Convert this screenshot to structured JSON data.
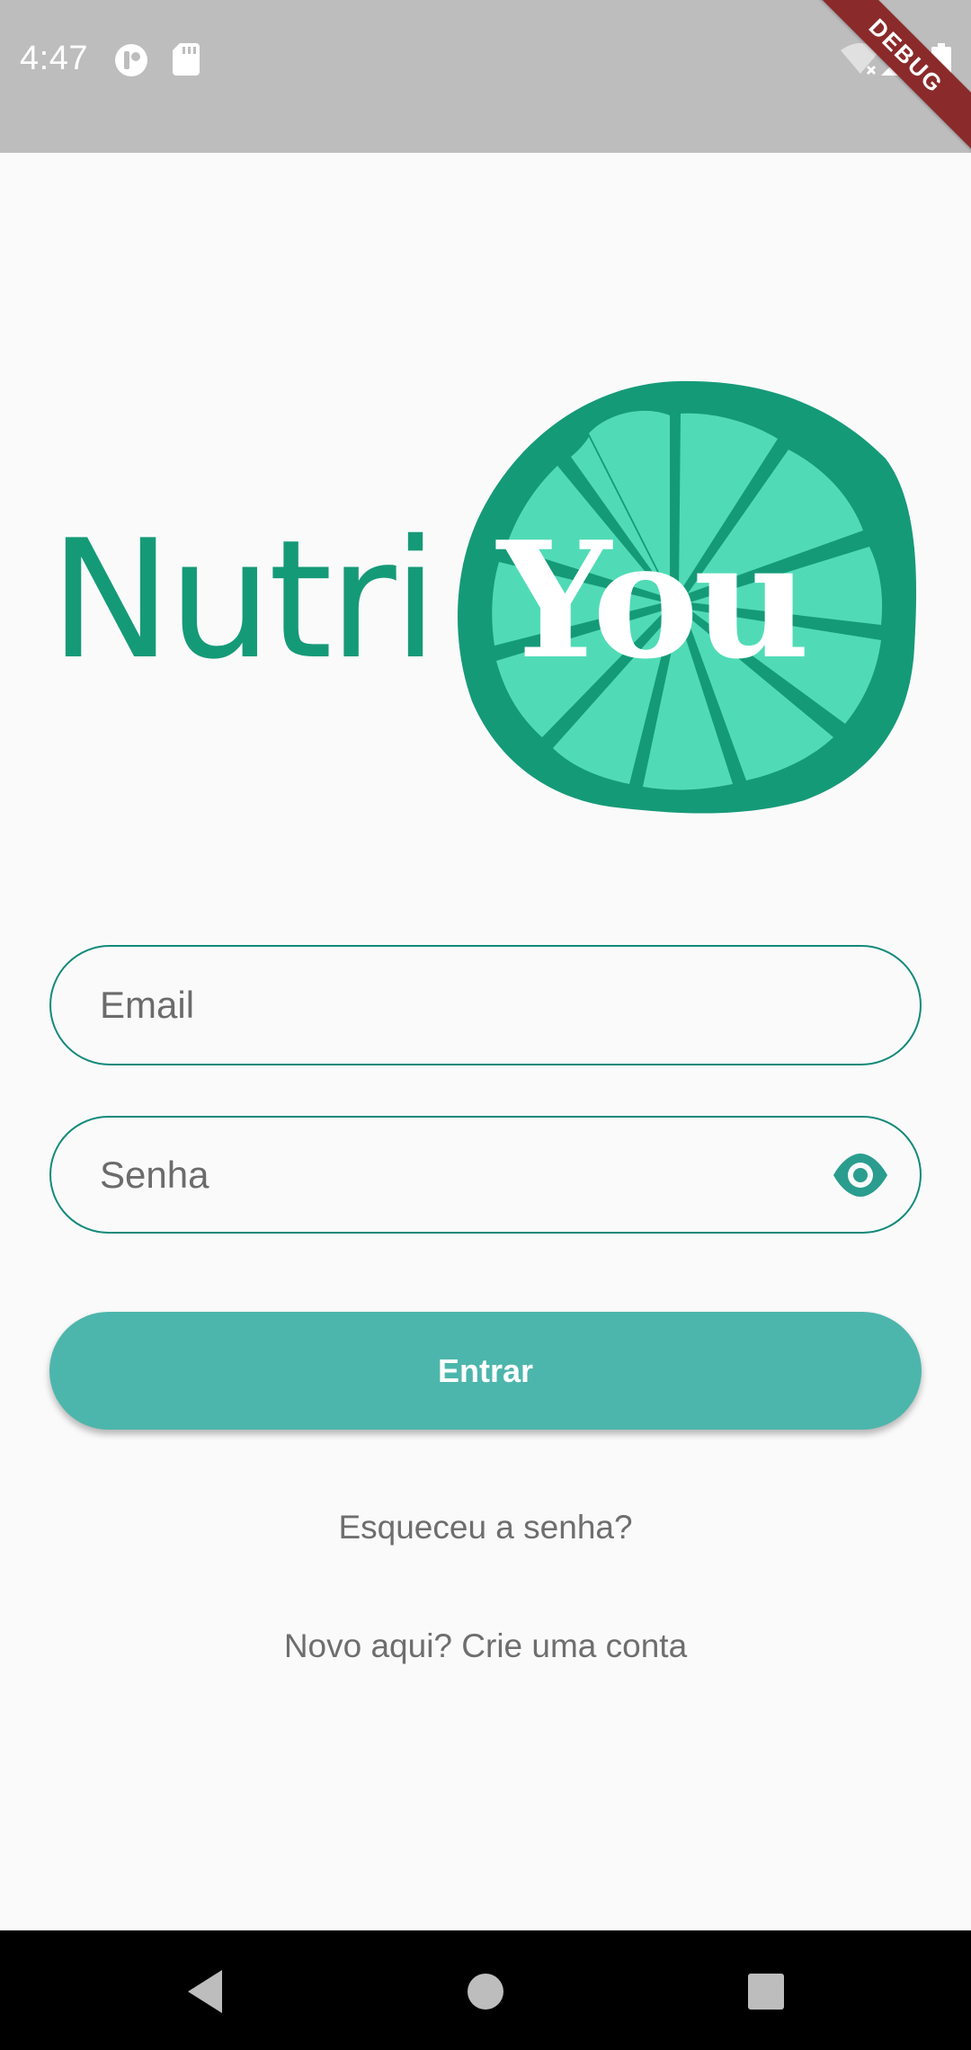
{
  "status_bar": {
    "time": "4:47",
    "debug_label": "DEBUG",
    "left_icons": [
      "notification-app-icon",
      "sd-card-icon"
    ],
    "right_icons": [
      "wifi-off-icon",
      "signal-icon",
      "battery-icon"
    ]
  },
  "logo": {
    "text_left": "Nutri",
    "text_right": "You",
    "colors": {
      "dark_green": "#159a78",
      "light_green": "#50dbb6"
    }
  },
  "form": {
    "email_placeholder": "Email",
    "password_placeholder": "Senha",
    "password_toggle_icon": "eye-icon",
    "login_label": "Entrar",
    "forgot_password": "Esqueceu a senha?",
    "signup": "Novo aqui? Crie uma conta"
  },
  "colors": {
    "accent": "#4db6ac",
    "border": "#128a7a",
    "background": "#fafafa"
  },
  "nav_bar": {
    "icons": [
      "back-icon",
      "home-icon",
      "recents-icon"
    ]
  }
}
